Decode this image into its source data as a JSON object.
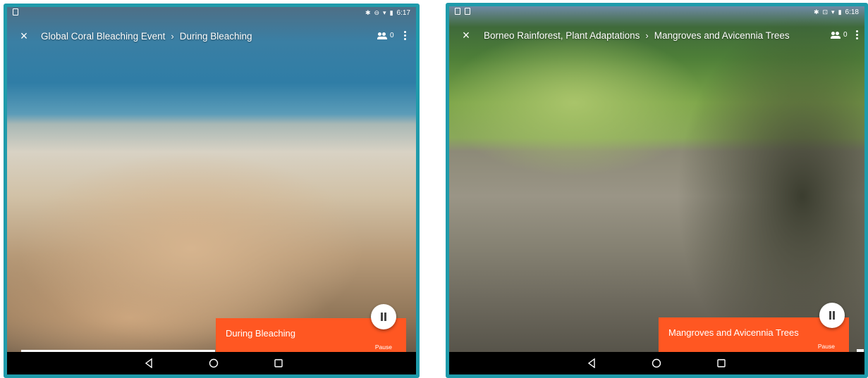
{
  "screens": [
    {
      "statusbar": {
        "time": "6:17"
      },
      "topbar": {
        "close_glyph": "×",
        "crumb_parent": "Global Coral Bleaching Event",
        "crumb_sep": "›",
        "crumb_current": "During Bleaching",
        "people_count": "0"
      },
      "card": {
        "title": "During Bleaching",
        "pause_label": "Pause"
      },
      "icons": [
        "close-icon",
        "people-icon",
        "more-vert-icon",
        "pause-icon",
        "back-icon",
        "home-icon",
        "recents-icon"
      ],
      "colors": {
        "frame": "#1f9bab",
        "card": "#ff5722"
      }
    },
    {
      "statusbar": {
        "time": "6:18"
      },
      "topbar": {
        "close_glyph": "×",
        "crumb_parent": "Borneo Rainforest, Plant Adaptations",
        "crumb_sep": "›",
        "crumb_current": "Mangroves and Avicennia Trees",
        "people_count": "0"
      },
      "card": {
        "title": "Mangroves and Avicennia Trees",
        "pause_label": "Pause"
      },
      "icons": [
        "close-icon",
        "people-icon",
        "more-vert-icon",
        "pause-icon",
        "back-icon",
        "home-icon",
        "recents-icon"
      ],
      "colors": {
        "frame": "#1f9bab",
        "card": "#ff5722"
      }
    }
  ]
}
